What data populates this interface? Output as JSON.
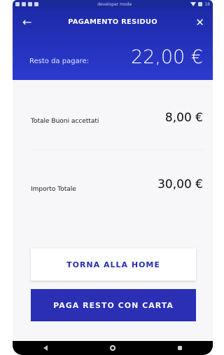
{
  "statusbar": {
    "mode_text": "developer mode",
    "right_text": "18"
  },
  "header": {
    "title": "PAGAMENTO RESIDUO",
    "rest_label": "Resto da pagare:",
    "rest_value": "22,00 €"
  },
  "rows": [
    {
      "label": "Totale Buoni accettati",
      "value": "8,00 €"
    },
    {
      "label": "Importo Totale",
      "value": "30,00 €"
    }
  ],
  "buttons": {
    "home_label": "TORNA ALLA HOME",
    "pay_label": "PAGA RESTO CON CARTA"
  },
  "icons": {
    "back": "arrow-left-icon",
    "close": "close-icon"
  },
  "colors": {
    "header_bg": "#1d2aa8",
    "primary_button": "#2a2fb4",
    "secondary_text": "#2632b0"
  }
}
